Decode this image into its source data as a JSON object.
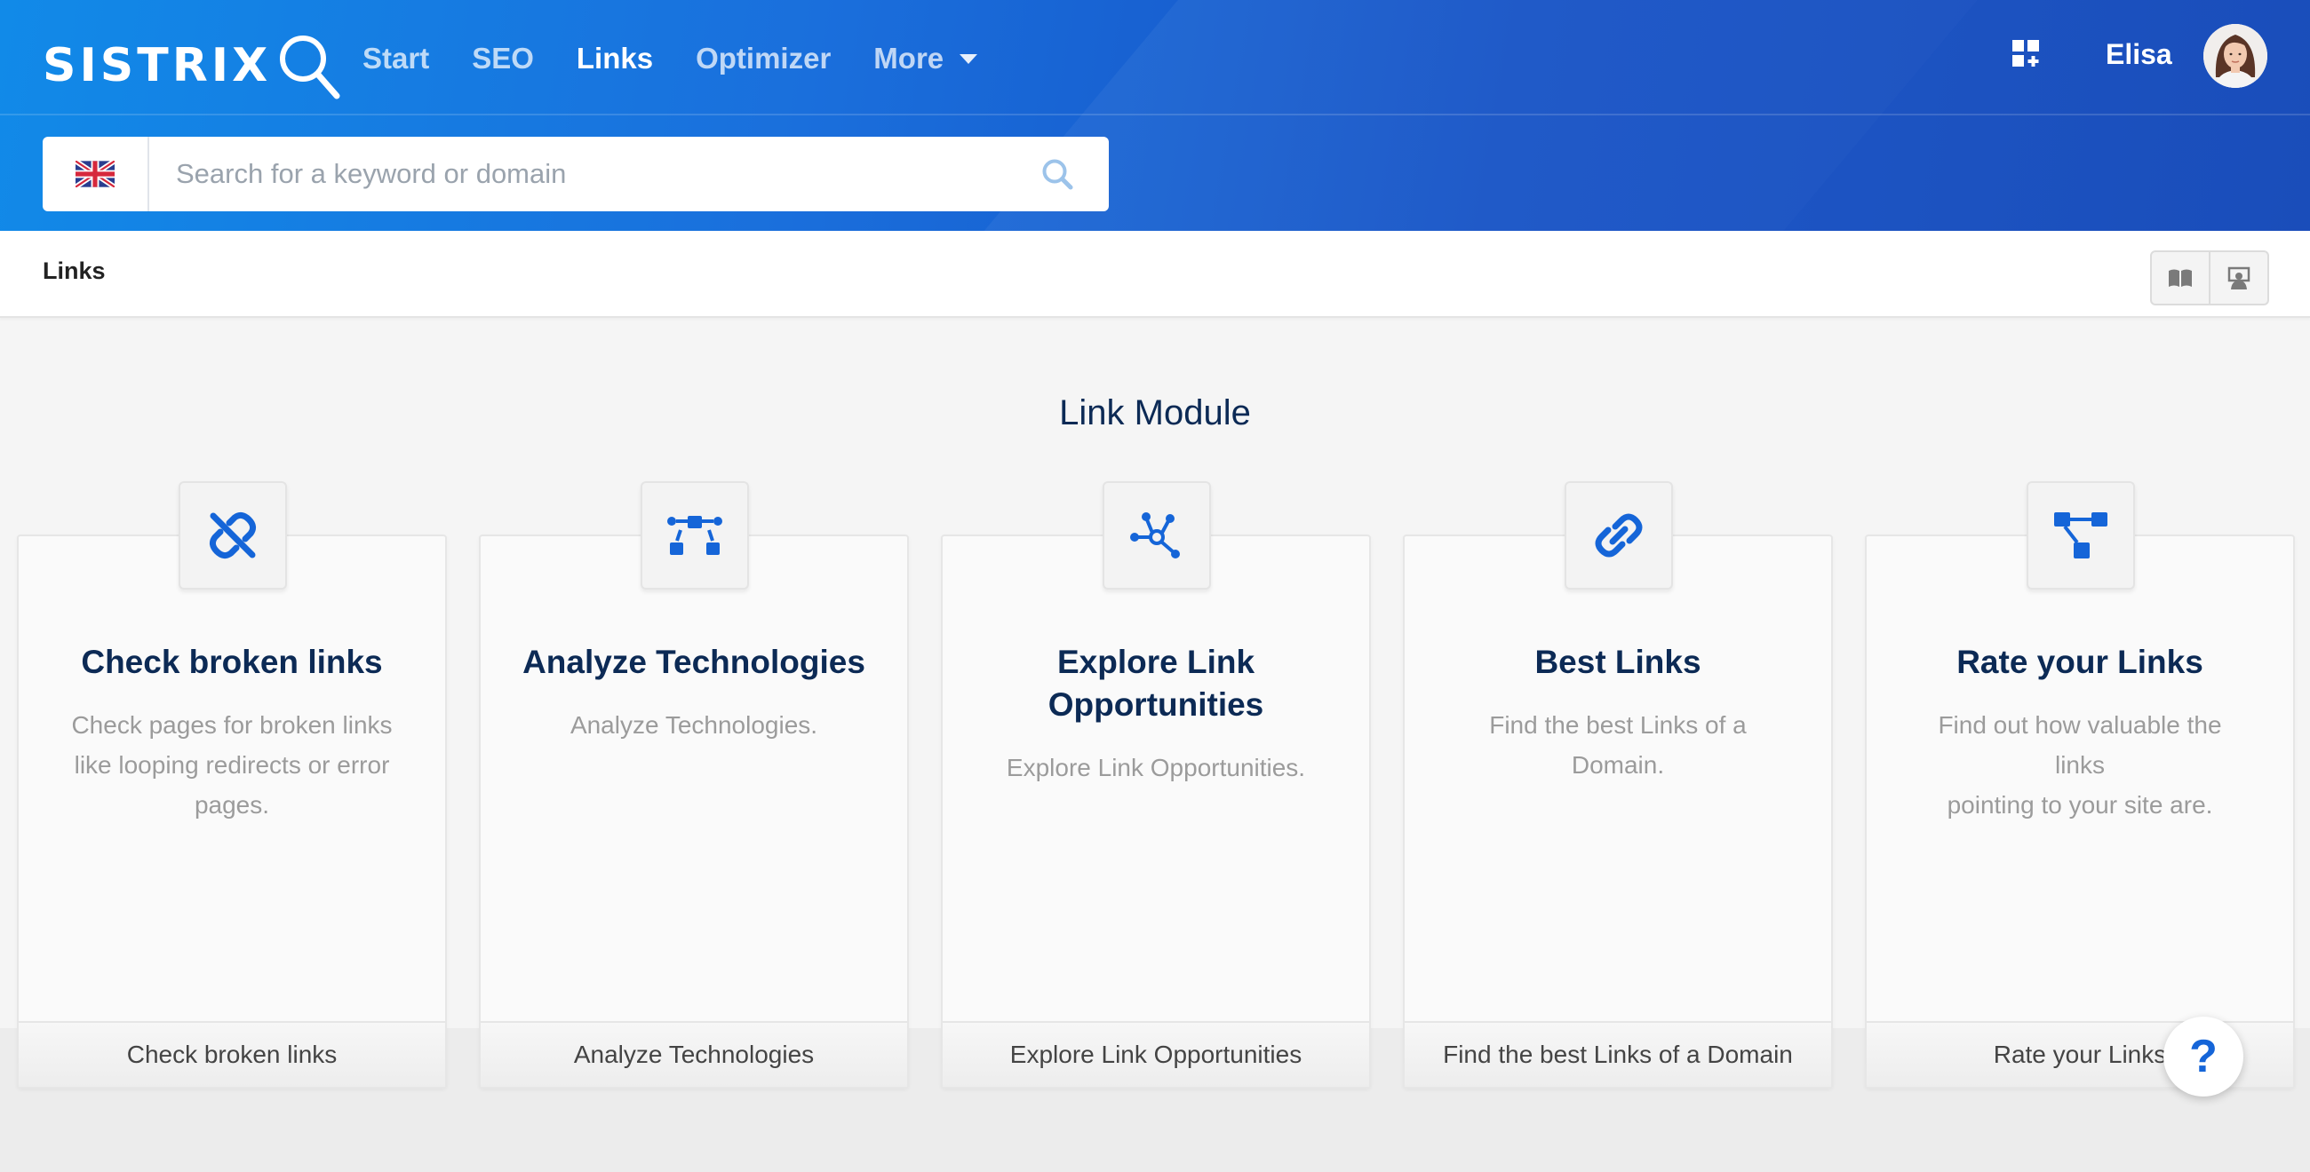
{
  "brand": {
    "logo_text": "SISTRIX"
  },
  "nav": {
    "items": [
      {
        "label": "Start"
      },
      {
        "label": "SEO"
      },
      {
        "label": "Links"
      },
      {
        "label": "Optimizer"
      },
      {
        "label": "More"
      }
    ],
    "active": "Links"
  },
  "user": {
    "name": "Elisa"
  },
  "search": {
    "placeholder": "Search for a keyword or domain",
    "value": "",
    "country": "UK"
  },
  "breadcrumb": {
    "title": "Links"
  },
  "main": {
    "section_title": "Link Module",
    "cards": [
      {
        "icon": "broken-link-icon",
        "title_lines": [
          "Check broken links"
        ],
        "description_lines": [
          "Check pages for broken links",
          "like looping redirects or error",
          "pages."
        ],
        "footer": "Check broken links"
      },
      {
        "icon": "technologies-icon",
        "title_lines": [
          "Analyze Technologies"
        ],
        "description_lines": [
          "Analyze Technologies."
        ],
        "footer": "Analyze Technologies"
      },
      {
        "icon": "network-icon",
        "title_lines": [
          "Explore Link",
          "Opportunities"
        ],
        "description_lines": [
          "Explore Link Opportunities."
        ],
        "footer": "Explore Link Opportunities"
      },
      {
        "icon": "link-icon",
        "title_lines": [
          "Best Links"
        ],
        "description_lines": [
          "Find the best Links of a",
          "Domain."
        ],
        "footer": "Find the best Links of a Domain"
      },
      {
        "icon": "hierarchy-icon",
        "title_lines": [
          "Rate your Links"
        ],
        "description_lines": [
          "Find out how valuable the links",
          "pointing to your site are."
        ],
        "footer": "Rate your Links"
      }
    ]
  },
  "help": {
    "label": "?"
  },
  "colors": {
    "accent": "#1565d8",
    "title": "#0c2a55",
    "header_start": "#118ae8",
    "header_end": "#1146b8"
  }
}
